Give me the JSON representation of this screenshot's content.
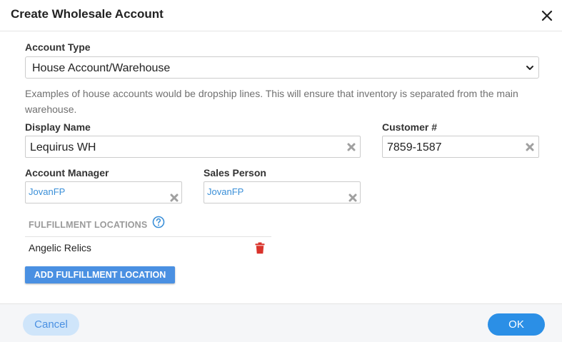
{
  "dialog": {
    "title": "Create Wholesale Account"
  },
  "account_type": {
    "label": "Account Type",
    "selected": "House Account/Warehouse",
    "help_text": "Examples of house accounts would be dropship lines. This will ensure that inventory is separated from the main warehouse."
  },
  "display_name": {
    "label": "Display Name",
    "value": "Lequirus WH"
  },
  "customer_number": {
    "label": "Customer #",
    "value": "7859-1587"
  },
  "account_manager": {
    "label": "Account Manager",
    "value": "JovanFP"
  },
  "sales_person": {
    "label": "Sales Person",
    "value": "JovanFP"
  },
  "fulfillment": {
    "label": "FULFILLMENT LOCATIONS",
    "locations": [
      {
        "name": "Angelic Relics"
      }
    ],
    "add_button": "ADD FULFILLMENT LOCATION"
  },
  "footer": {
    "cancel_label": "Cancel",
    "ok_label": "OK"
  },
  "colors": {
    "accent": "#2b8fe6",
    "link": "#3a8fd8",
    "danger": "#d9332b",
    "muted": "#9a9a9a"
  },
  "icons": [
    "close-icon",
    "chevron-down-icon",
    "clear-icon",
    "help-circle-icon",
    "trash-icon"
  ]
}
